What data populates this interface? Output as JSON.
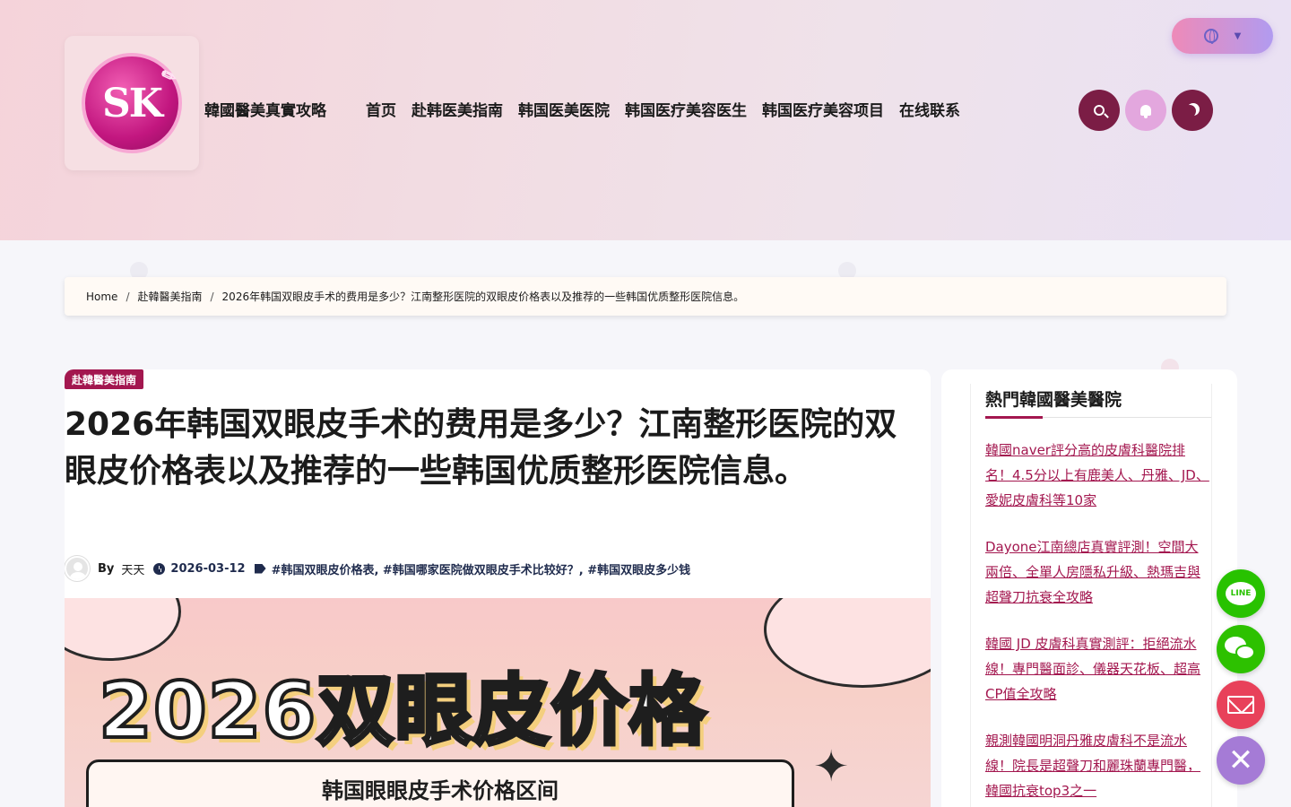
{
  "header": {
    "logo_text": "SK",
    "site_title": "韓國醫美真實攻略",
    "nav": [
      "首页",
      "赴韩医美指南",
      "韩国医美医院",
      "韩国医疗美容医生",
      "韩国医疗美容项目",
      "在线联系"
    ],
    "language_caret": "▼"
  },
  "breadcrumb": {
    "items": [
      "Home",
      "赴韓醫美指南",
      "2026年韩国双眼皮手术的费用是多少？江南整形医院的双眼皮价格表以及推荐的一些韩国优质整形医院信息。"
    ],
    "separator": "/"
  },
  "post": {
    "category": "赴韓醫美指南",
    "title": "2026年韩国双眼皮手术的费用是多少？江南整形医院的双眼皮价格表以及推荐的一些韩国优质整形医院信息。",
    "by": "By",
    "author": "天天",
    "date": "2026-03-12",
    "tags": "#韩国双眼皮价格表, #韩国哪家医院做双眼皮手术比较好？, #韩国双眼皮多少钱",
    "hero_title": "2026双眼皮价格",
    "hero_subtitle": "韩国眼眼皮手术价格区间"
  },
  "sidebar": {
    "widget_title": "熱門韓國醫美醫院",
    "posts": [
      "韓國naver評分高的皮膚科醫院排名！4.5分以上有鹿美人、丹雅、JD、 愛妮皮膚科等10家",
      "Dayone江南總店真實評測！空間大兩倍、全單人房隱私升級、熱瑪吉與超聲刀抗衰全攻略",
      "韓國 JD 皮膚科真實測評：拒絕流水線！專門醫面診、儀器天花板、超高CP值全攻略",
      "親測韓國明洞丹雅皮膚科不是流水線！院長是超聲刀和麗珠蘭專門醫，韓國抗衰top3之一"
    ]
  },
  "floating": {
    "line_label": "LINE",
    "close_label": "✕"
  }
}
